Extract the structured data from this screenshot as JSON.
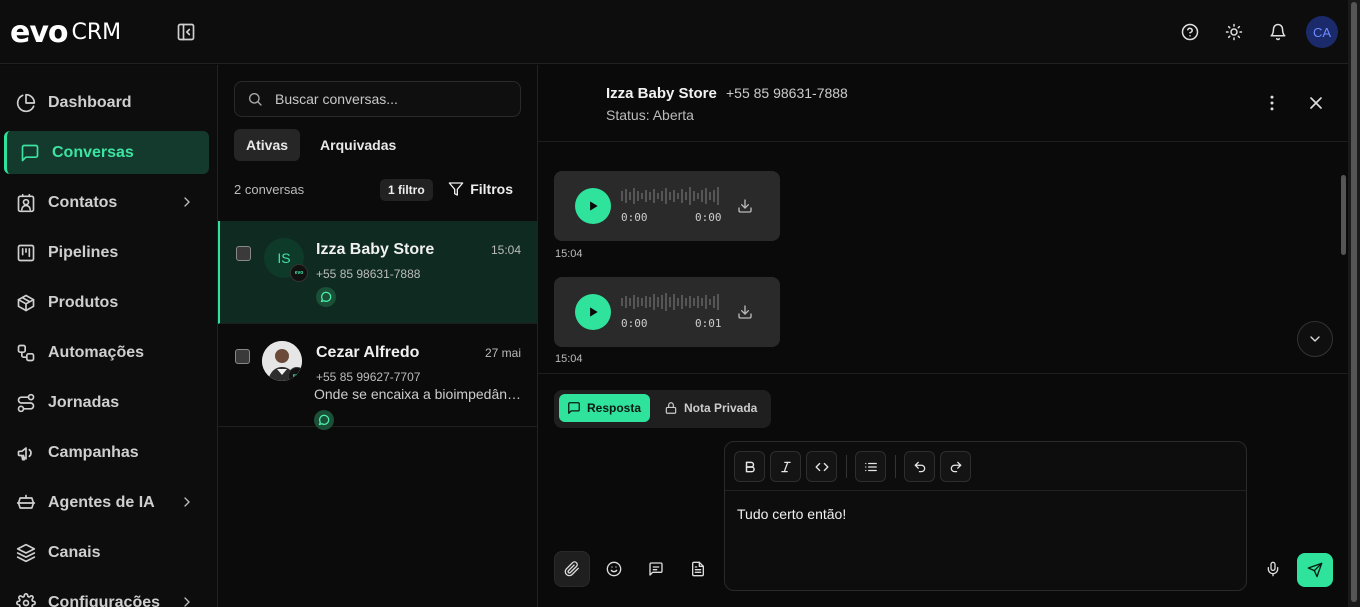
{
  "brand": {
    "logo_text": "evo",
    "logo_suffix": "CRM"
  },
  "topbar": {
    "icons": [
      "help-icon",
      "sun-icon",
      "bell-icon"
    ],
    "avatar_initials": "CA"
  },
  "sidebar": {
    "items": [
      {
        "label": "Dashboard",
        "icon": "dashboard-icon"
      },
      {
        "label": "Conversas",
        "icon": "chat-icon",
        "active": true
      },
      {
        "label": "Contatos",
        "icon": "contacts-icon",
        "has_children": true
      },
      {
        "label": "Pipelines",
        "icon": "kanban-icon"
      },
      {
        "label": "Produtos",
        "icon": "package-icon"
      },
      {
        "label": "Automações",
        "icon": "workflow-icon"
      },
      {
        "label": "Jornadas",
        "icon": "route-icon"
      },
      {
        "label": "Campanhas",
        "icon": "megaphone-icon"
      },
      {
        "label": "Agentes de IA",
        "icon": "bot-icon",
        "has_children": true
      },
      {
        "label": "Canais",
        "icon": "layers-icon"
      },
      {
        "label": "Configurações",
        "icon": "settings-icon",
        "has_children": true
      }
    ]
  },
  "conversations": {
    "search_placeholder": "Buscar conversas...",
    "tabs": [
      {
        "label": "Ativas",
        "active": true
      },
      {
        "label": "Arquivadas",
        "active": false
      }
    ],
    "count_text": "2 conversas",
    "filter_badge": "1 filtro",
    "filter_button": "Filtros",
    "list": [
      {
        "name": "Izza Baby Store",
        "initials": "IS",
        "phone": "+55 85 98631-7888",
        "time": "15:04",
        "preview": "",
        "selected": true
      },
      {
        "name": "Cezar Alfredo",
        "initials": "",
        "phone": "+55 85 99627-7707",
        "time": "27 mai",
        "preview": "Onde se encaixa a bioimpedância...",
        "selected": false
      }
    ]
  },
  "chat": {
    "contact_name": "Izza Baby Store",
    "contact_phone": "+55 85 98631-7888",
    "status": "Status: Aberta",
    "messages": [
      {
        "type": "audio",
        "current": "0:00",
        "duration": "0:00",
        "time": "15:04"
      },
      {
        "type": "audio",
        "current": "0:00",
        "duration": "0:01",
        "time": "15:04"
      }
    ],
    "composer": {
      "mode_reply": "Resposta",
      "mode_private": "Nota Privada",
      "text": "Tudo certo então!"
    }
  },
  "colors": {
    "accent": "#2fe39d",
    "background": "#0b0b0b",
    "active_nav_bg": "#133a2c"
  }
}
